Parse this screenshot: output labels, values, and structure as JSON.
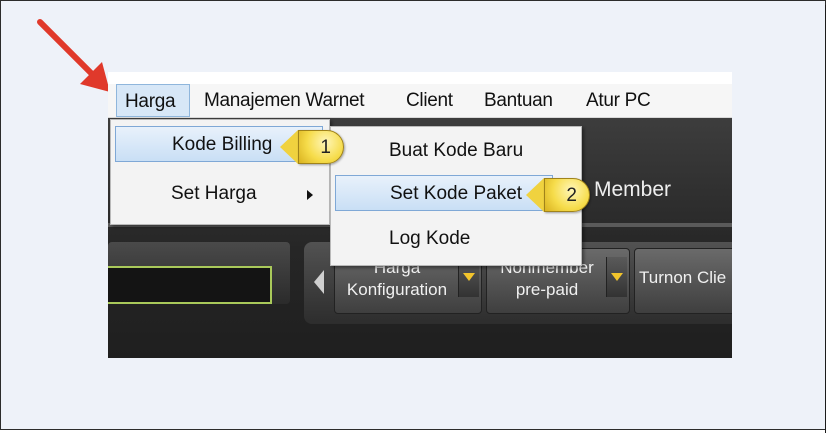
{
  "menubar": {
    "items": [
      {
        "label": "Harga"
      },
      {
        "label": "Manajemen Warnet"
      },
      {
        "label": "Client"
      },
      {
        "label": "Bantuan"
      },
      {
        "label": "Atur PC"
      }
    ]
  },
  "harga_menu": {
    "items": [
      {
        "label": "Kode Billing"
      },
      {
        "label": "Set Harga"
      }
    ]
  },
  "kode_billing_menu": {
    "items": [
      {
        "label": "Buat Kode Baru"
      },
      {
        "label": "Set Kode Paket"
      },
      {
        "label": "Log Kode"
      }
    ]
  },
  "toolbar": {
    "buttons": [
      {
        "line1": "Harga",
        "line2": "Konfiguration"
      },
      {
        "line1": "Nonmember",
        "line2": "pre-paid"
      },
      {
        "line1": "Turnon Clie",
        "line2": ""
      }
    ],
    "member_label": "Member"
  },
  "callouts": [
    {
      "number": "1"
    },
    {
      "number": "2"
    }
  ],
  "colors": {
    "accent_arrow": "#e0392b",
    "badge_yellow": "#f6dc4a",
    "input_border": "#a9c95a"
  },
  "icons": [
    "red-pointer-arrow-icon",
    "submenu-chevron-icon",
    "member-icon",
    "dropdown-caret-icon",
    "scroll-left-icon"
  ]
}
